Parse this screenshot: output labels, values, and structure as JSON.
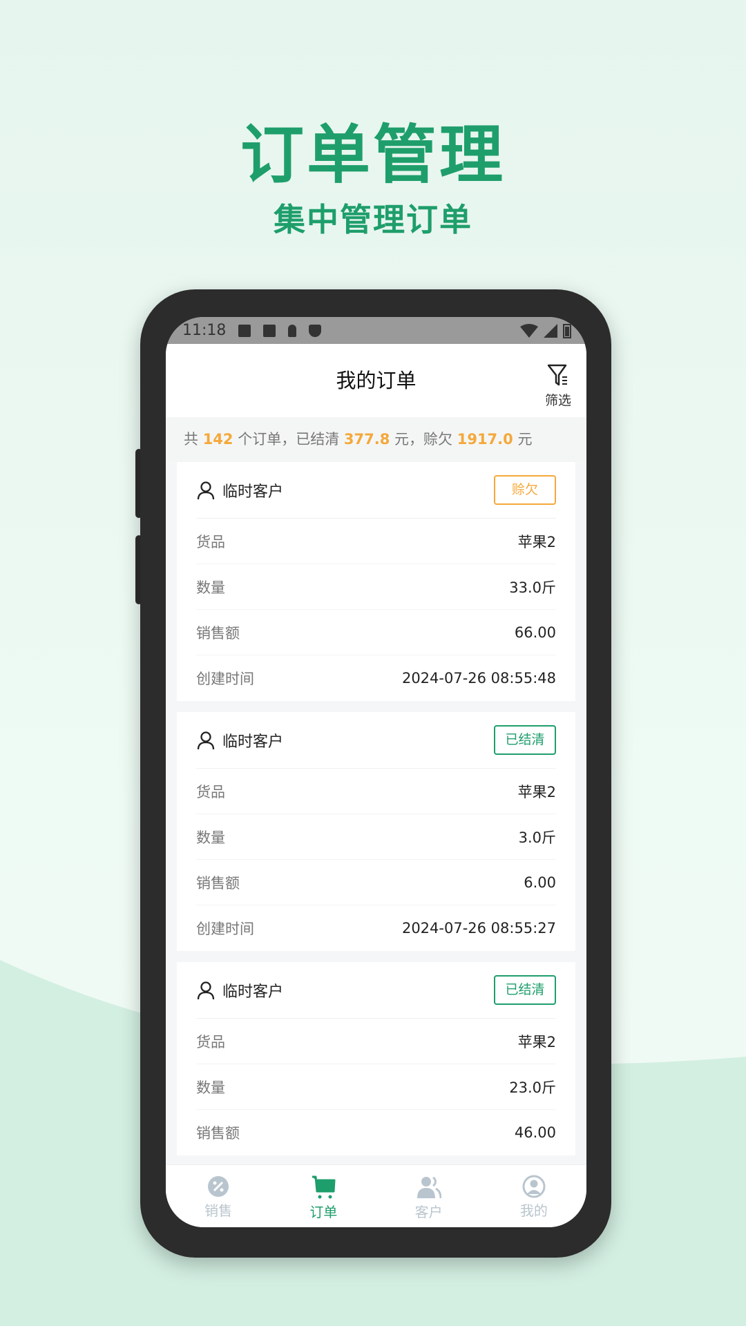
{
  "promo": {
    "title": "订单管理",
    "subtitle": "集中管理订单"
  },
  "status_bar": {
    "time": "11:18"
  },
  "header": {
    "title": "我的订单",
    "filter_label": "筛选"
  },
  "summary": {
    "prefix": "共",
    "count": "142",
    "mid1": "个订单，已结清",
    "paid": "377.8",
    "mid2": "元，赊欠",
    "owed": "1917.0",
    "suffix": "元"
  },
  "colors": {
    "accent": "#1e9e6b",
    "warning": "#f5a83a"
  },
  "labels": {
    "goods": "货品",
    "qty": "数量",
    "amount": "销售额",
    "created": "创建时间"
  },
  "orders": [
    {
      "customer": "临时客户",
      "status": "赊欠",
      "goods": "苹果2",
      "qty": "33.0斤",
      "amount": "66.00",
      "created": "2024-07-26 08:55:48"
    },
    {
      "customer": "临时客户",
      "status": "已结清",
      "goods": "苹果2",
      "qty": "3.0斤",
      "amount": "6.00",
      "created": "2024-07-26 08:55:27"
    },
    {
      "customer": "临时客户",
      "status": "已结清",
      "goods": "苹果2",
      "qty": "23.0斤",
      "amount": "46.00"
    }
  ],
  "nav": [
    {
      "label": "销售",
      "icon": "discount-badge-icon"
    },
    {
      "label": "订单",
      "icon": "cart-icon",
      "active": true
    },
    {
      "label": "客户",
      "icon": "customers-icon"
    },
    {
      "label": "我的",
      "icon": "profile-icon"
    }
  ]
}
